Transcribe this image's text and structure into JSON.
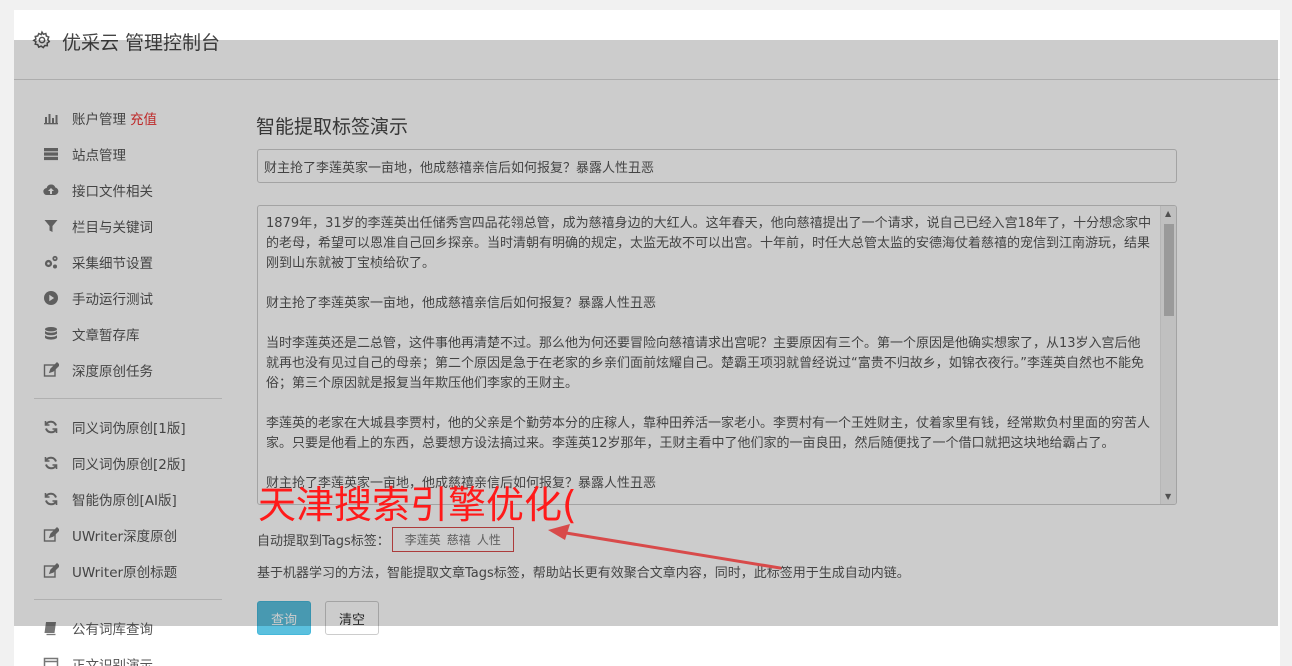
{
  "header": {
    "title": "优采云 管理控制台",
    "icon": "gear-icon"
  },
  "sidebar": {
    "group1": [
      {
        "label": "账户管理",
        "badge": "充值",
        "icon": "bar-chart-icon"
      },
      {
        "label": "站点管理",
        "icon": "server-icon"
      },
      {
        "label": "接口文件相关",
        "icon": "cloud-upload-icon"
      },
      {
        "label": "栏目与关键词",
        "icon": "filter-icon"
      },
      {
        "label": "采集细节设置",
        "icon": "gears-icon"
      },
      {
        "label": "手动运行测试",
        "icon": "play-circle-icon"
      },
      {
        "label": "文章暂存库",
        "icon": "database-icon"
      },
      {
        "label": "深度原创任务",
        "icon": "edit-icon"
      }
    ],
    "group2": [
      {
        "label": "同义词伪原创[1版]",
        "icon": "refresh-icon"
      },
      {
        "label": "同义词伪原创[2版]",
        "icon": "refresh-icon"
      },
      {
        "label": "智能伪原创[AI版]",
        "icon": "refresh-icon"
      },
      {
        "label": "UWriter深度原创",
        "icon": "edit-icon"
      },
      {
        "label": "UWriter原创标题",
        "icon": "edit-icon"
      }
    ],
    "group3": [
      {
        "label": "公有词库查询",
        "icon": "book-icon"
      },
      {
        "label": "正文识别演示",
        "icon": "window-icon"
      }
    ]
  },
  "main": {
    "page_title": "智能提取标签演示",
    "title_input_value": "财主抢了李莲英家一亩地，他成慈禧亲信后如何报复？暴露人性丑恶",
    "content_paragraphs": [
      "1879年，31岁的李莲英出任储秀宫四品花翎总管，成为慈禧身边的大红人。这年春天，他向慈禧提出了一个请求，说自己已经入宫18年了，十分想念家中的老母，希望可以恩准自己回乡探亲。当时清朝有明确的规定，太监无故不可以出宫。十年前，时任大总管太监的安德海仗着慈禧的宠信到江南游玩，结果刚到山东就被丁宝桢给砍了。",
      "财主抢了李莲英家一亩地，他成慈禧亲信后如何报复？暴露人性丑恶",
      "当时李莲英还是二总管，这件事他再清楚不过。那么他为何还要冒险向慈禧请求出宫呢？主要原因有三个。第一个原因是他确实想家了，从13岁入宫后他就再也没有见过自己的母亲；第二个原因是急于在老家的乡亲们面前炫耀自己。楚霸王项羽就曾经说过“富贵不归故乡，如锦衣夜行。”李莲英自然也不能免俗；第三个原因就是报复当年欺压他们李家的王财主。",
      "李莲英的老家在大城县李贾村，他的父亲是个勤劳本分的庄稼人，靠种田养活一家老小。李贾村有一个王姓财主，仗着家里有钱，经常欺负村里面的穷苦人家。只要是他看上的东西，总要想方设法搞过来。李莲英12岁那年，王财主看中了他们家的一亩良田，然后随便找了一个借口就把这块地给霸占了。",
      "财主抢了李莲英家一亩地，他成慈禧亲信后如何报复？暴露人性丑恶"
    ],
    "tags_label": "自动提取到Tags标签：",
    "tags": [
      "李莲英",
      "慈禧",
      "人性"
    ],
    "description": "基于机器学习的方法，智能提取文章Tags标签，帮助站长更有效聚合文章内容，同时，此标签用于生成自动内链。",
    "query_button": "查询",
    "clear_button": "清空"
  },
  "watermark": {
    "text": "天津搜索引擎优化(",
    "color": "#ff1a1a"
  }
}
